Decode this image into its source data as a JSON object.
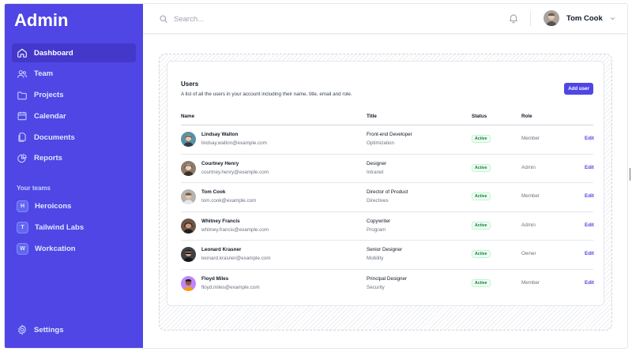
{
  "sidebar": {
    "brand": "Admin",
    "nav": [
      {
        "label": "Dashboard",
        "icon": "home-icon",
        "active": true
      },
      {
        "label": "Team",
        "icon": "users-icon",
        "active": false
      },
      {
        "label": "Projects",
        "icon": "folder-icon",
        "active": false
      },
      {
        "label": "Calendar",
        "icon": "calendar-icon",
        "active": false
      },
      {
        "label": "Documents",
        "icon": "documents-icon",
        "active": false
      },
      {
        "label": "Reports",
        "icon": "chart-pie-icon",
        "active": false
      }
    ],
    "teams_heading": "Your teams",
    "teams": [
      {
        "initial": "H",
        "label": "Heroicons"
      },
      {
        "initial": "T",
        "label": "Tailwind Labs"
      },
      {
        "initial": "W",
        "label": "Workcation"
      }
    ],
    "settings_label": "Settings"
  },
  "topbar": {
    "search_placeholder": "Search...",
    "user_name": "Tom Cook"
  },
  "users": {
    "title": "Users",
    "description": "A list of all the users in your account including their name, title, email and role.",
    "add_label": "Add user",
    "columns": {
      "name": "Name",
      "title": "Title",
      "status": "Status",
      "role": "Role"
    },
    "rows": [
      {
        "name": "Lindsay Walton",
        "email": "lindsay.walton@example.com",
        "title": "Front-end Developer",
        "dept": "Optimization",
        "status": "Active",
        "role": "Member",
        "edit": "Edit"
      },
      {
        "name": "Courtney Henry",
        "email": "courtney.henry@example.com",
        "title": "Designer",
        "dept": "Intranet",
        "status": "Active",
        "role": "Admin",
        "edit": "Edit"
      },
      {
        "name": "Tom Cook",
        "email": "tom.cook@example.com",
        "title": "Director of Product",
        "dept": "Directives",
        "status": "Active",
        "role": "Member",
        "edit": "Edit"
      },
      {
        "name": "Whitney Francis",
        "email": "whitney.francis@example.com",
        "title": "Copywriter",
        "dept": "Program",
        "status": "Active",
        "role": "Admin",
        "edit": "Edit"
      },
      {
        "name": "Leonard Krasner",
        "email": "leonard.krasner@example.com",
        "title": "Senior Designer",
        "dept": "Mobility",
        "status": "Active",
        "role": "Owner",
        "edit": "Edit"
      },
      {
        "name": "Floyd Miles",
        "email": "floyd.miles@example.com",
        "title": "Principal Designer",
        "dept": "Security",
        "status": "Active",
        "role": "Member",
        "edit": "Edit"
      }
    ]
  },
  "colors": {
    "accent": "#4f46e5",
    "accent_dark": "#4338ca",
    "status_green": "#15803d"
  }
}
